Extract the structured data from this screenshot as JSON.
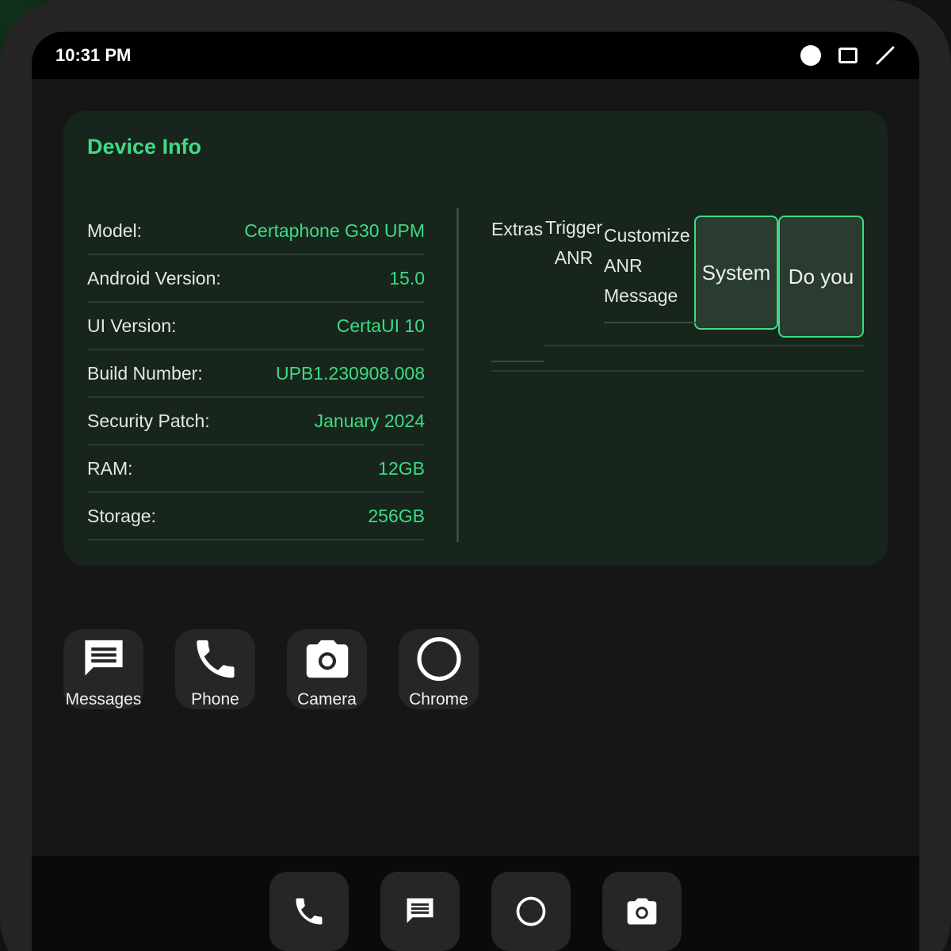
{
  "status_bar": {
    "time": "10:31 PM",
    "icons": [
      "record-dot-icon",
      "window-square-icon",
      "pen-icon"
    ]
  },
  "device_info": {
    "title": "Device Info",
    "rows": [
      {
        "label": "Model:",
        "value": "Certaphone G30 UPM"
      },
      {
        "label": "Android Version:",
        "value": "15.0"
      },
      {
        "label": "UI Version:",
        "value": "CertaUI 10"
      },
      {
        "label": "Build Number:",
        "value": "UPB1.230908.008"
      },
      {
        "label": "Security Patch:",
        "value": "January 2024"
      },
      {
        "label": "RAM:",
        "value": "12GB"
      },
      {
        "label": "Storage:",
        "value": "256GB"
      }
    ]
  },
  "quick_actions": {
    "extras": "Extras",
    "trigger_anr": "Trigger ANR",
    "customize_anr": "Customize ANR Message",
    "system": "System",
    "do_you": "Do you"
  },
  "apps": [
    {
      "label": "Messages",
      "icon": "message-icon"
    },
    {
      "label": "Phone",
      "icon": "phone-icon"
    },
    {
      "label": "Camera",
      "icon": "camera-icon"
    },
    {
      "label": "Chrome",
      "icon": "circle-icon"
    }
  ],
  "dock": [
    {
      "icon": "phone-icon"
    },
    {
      "icon": "message-icon"
    },
    {
      "icon": "circle-icon"
    },
    {
      "icon": "camera-icon"
    }
  ],
  "colors": {
    "accent": "#3ddc84",
    "card_bg": "#17251c",
    "screen_bg": "#161616"
  }
}
